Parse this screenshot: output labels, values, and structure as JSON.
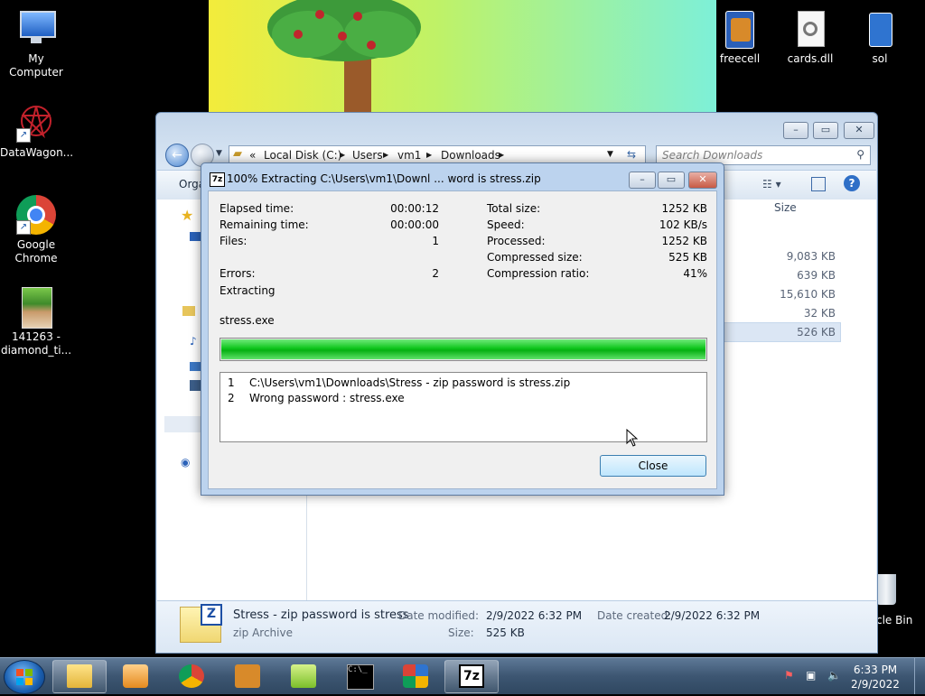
{
  "desktop": {
    "icons_left": [
      {
        "label": "My Computer"
      },
      {
        "label": "DataWagon..."
      },
      {
        "label": "Google Chrome"
      },
      {
        "label": "141263 - diamond_ti..."
      }
    ],
    "icons_right": [
      {
        "label": "freecell"
      },
      {
        "label": "cards.dll"
      },
      {
        "label": "sol"
      }
    ],
    "recycle_bin_label": "cle Bin"
  },
  "explorer": {
    "breadcrumb": [
      "«",
      "Local Disk (C:)",
      "Users",
      "vm1",
      "Downloads"
    ],
    "search_placeholder": "Search Downloads",
    "toolbar_left": "Orga",
    "column_size": "Size",
    "sizes": [
      "9,083 KB",
      "639 KB",
      "15,610 KB",
      "32 KB",
      "526 KB"
    ],
    "details": {
      "name": "Stress - zip password is stress",
      "type": "zip Archive",
      "date_modified_label": "Date modified:",
      "date_modified": "2/9/2022 6:32 PM",
      "date_created_label": "Date created:",
      "date_created": "2/9/2022 6:32 PM",
      "size_label": "Size:",
      "size": "525 KB"
    }
  },
  "dialog": {
    "app_icon_text": "7z",
    "title": "100% Extracting C:\\Users\\vm1\\Downl ... word is stress.zip",
    "left_stats": [
      {
        "label": "Elapsed time:",
        "value": "00:00:12"
      },
      {
        "label": "Remaining time:",
        "value": "00:00:00"
      },
      {
        "label": "Files:",
        "value": "1"
      },
      {
        "label": "Errors:",
        "value": "2"
      }
    ],
    "right_stats": [
      {
        "label": "Total size:",
        "value": "1252 KB"
      },
      {
        "label": "Speed:",
        "value": "102 KB/s"
      },
      {
        "label": "Processed:",
        "value": "1252 KB"
      },
      {
        "label": "Compressed size:",
        "value": "525 KB"
      },
      {
        "label": "Compression ratio:",
        "value": "41%"
      }
    ],
    "status": "Extracting",
    "current_file": "stress.exe",
    "progress_fraction": 1.0,
    "log": [
      {
        "n": "1",
        "text": "C:\\Users\\vm1\\Downloads\\Stress - zip password is stress.zip"
      },
      {
        "n": "2",
        "text": "Wrong password : stress.exe"
      }
    ],
    "close_label": "Close"
  },
  "taskbar": {
    "app_7zip_text": "7z",
    "time": "6:33 PM",
    "date": "2/9/2022"
  },
  "colors": {
    "progress_green": "#0ec51c",
    "title_bar": "#bcd3ee",
    "taskbar": "#3d5672"
  }
}
